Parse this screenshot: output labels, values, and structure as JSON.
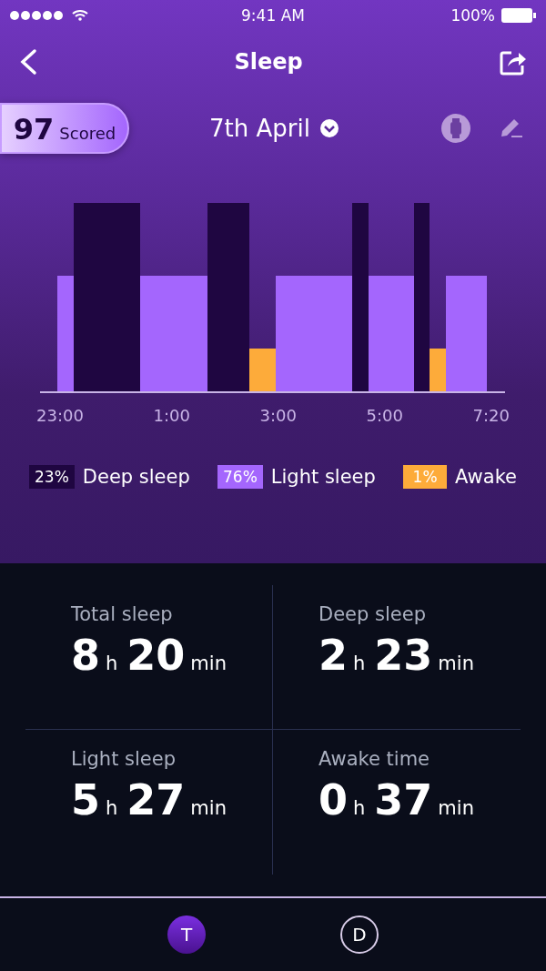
{
  "status_bar": {
    "time": "9:41 AM",
    "battery": "100%"
  },
  "nav": {
    "title": "Sleep"
  },
  "score": {
    "value": "97",
    "label": "Scored"
  },
  "date": {
    "label": "7th April"
  },
  "chart": {
    "axis_labels": [
      "23:00",
      "1:00",
      "3:00",
      "5:00",
      "7:20"
    ]
  },
  "legend": [
    {
      "percent": "23%",
      "label": "Deep sleep",
      "color": "#1f0641"
    },
    {
      "percent": "76%",
      "label": "Light sleep",
      "color": "#a466fd"
    },
    {
      "percent": "1%",
      "label": "Awake",
      "color": "#fdab3a"
    }
  ],
  "stats": [
    {
      "label": "Total sleep",
      "hours": "8",
      "h_unit": "h",
      "minutes": "20",
      "m_unit": "min"
    },
    {
      "label": "Deep sleep",
      "hours": "2",
      "h_unit": "h",
      "minutes": "23",
      "m_unit": "min"
    },
    {
      "label": "Light sleep",
      "hours": "5",
      "h_unit": "h",
      "minutes": "27",
      "m_unit": "min"
    },
    {
      "label": "Awake time",
      "hours": "0",
      "h_unit": "h",
      "minutes": "37",
      "m_unit": "min"
    }
  ],
  "tabs": [
    {
      "label": "T",
      "selected": true
    },
    {
      "label": "D",
      "selected": false
    }
  ]
}
